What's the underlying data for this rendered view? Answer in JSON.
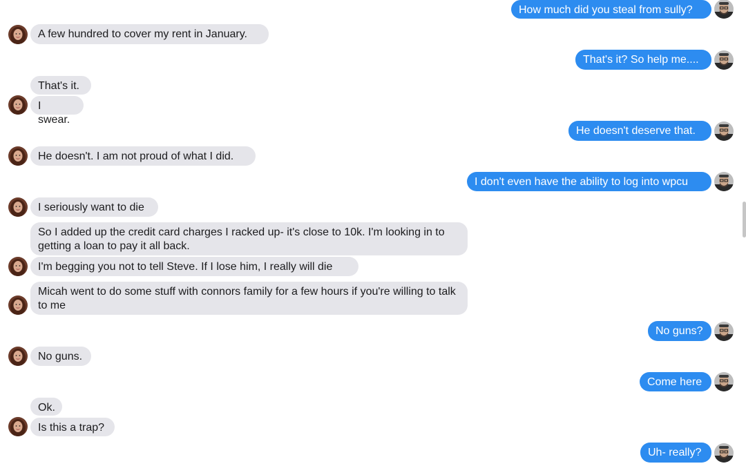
{
  "conversation": {
    "messages": [
      {
        "side": "out",
        "text": "How much did you steal from sully?",
        "avatar": true
      },
      {
        "side": "in",
        "text": "A few hundred to cover my rent in January.",
        "avatar": true
      },
      {
        "side": "out",
        "text": "That's it? So help me....",
        "avatar": true
      },
      {
        "side": "in",
        "text": "That's it.",
        "avatar": false
      },
      {
        "side": "in",
        "text": "I swear.",
        "avatar": true
      },
      {
        "side": "out",
        "text": "He doesn't deserve that.",
        "avatar": true
      },
      {
        "side": "in",
        "text": "He doesn't. I am not proud of what I did.",
        "avatar": true
      },
      {
        "side": "out",
        "text": "I don't even have the ability to log into wpcu",
        "avatar": true
      },
      {
        "side": "in",
        "text": "I seriously want to die",
        "avatar": true
      },
      {
        "side": "in",
        "text": "So I added up the credit card charges I racked up- it's close to 10k. I'm looking in to getting a loan to pay it all back.",
        "avatar": false
      },
      {
        "side": "in",
        "text": "I'm begging you not to tell Steve. If I lose him, I really will die",
        "avatar": true
      },
      {
        "side": "in",
        "text": "Micah went to do some stuff with connors family for a few hours if you're willing to talk to me",
        "avatar": true
      },
      {
        "side": "out",
        "text": "No guns?",
        "avatar": true
      },
      {
        "side": "in",
        "text": "No guns.",
        "avatar": true
      },
      {
        "side": "out",
        "text": "Come here",
        "avatar": true
      },
      {
        "side": "in",
        "text": "Ok.",
        "avatar": false
      },
      {
        "side": "in",
        "text": "Is this a trap?",
        "avatar": true
      },
      {
        "side": "out",
        "text": "Uh- really?",
        "avatar": true
      }
    ]
  },
  "colors": {
    "outgoing_bubble": "#2d8cf0",
    "incoming_bubble": "#e5e5ea",
    "outgoing_text": "#ffffff",
    "incoming_text": "#1c1c1e"
  },
  "icons": {
    "outgoing_avatar": "man-avatar-icon",
    "incoming_avatar": "woman-avatar-icon"
  }
}
